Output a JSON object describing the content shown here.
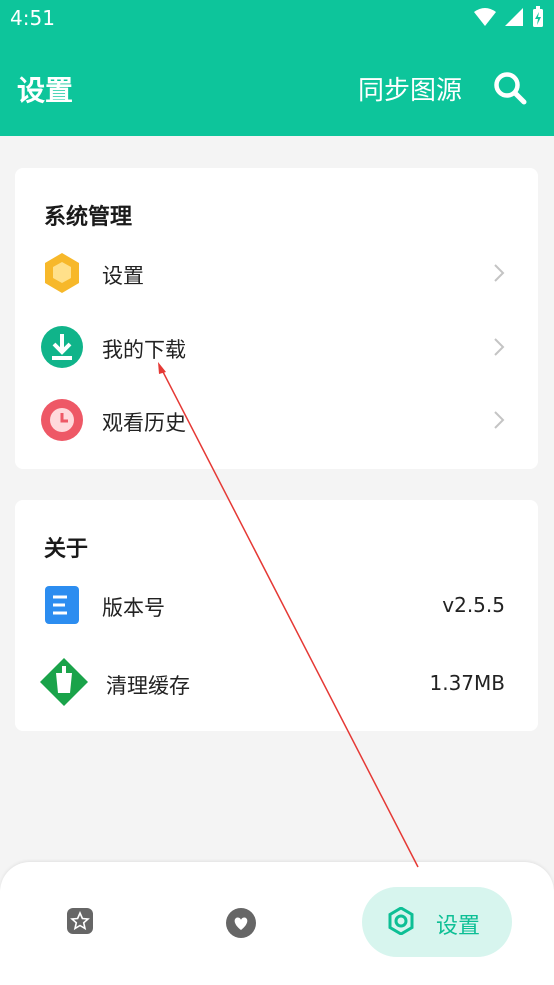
{
  "status_bar": {
    "time": "4:51"
  },
  "header": {
    "title": "设置",
    "sync_label": "同步图源",
    "search_icon": "search-icon"
  },
  "system_section": {
    "title": "系统管理",
    "items": [
      {
        "label": "设置",
        "icon": "hexagon-settings-icon"
      },
      {
        "label": "我的下载",
        "icon": "download-icon"
      },
      {
        "label": "观看历史",
        "icon": "clock-icon"
      }
    ]
  },
  "about_section": {
    "title": "关于",
    "items": [
      {
        "label": "版本号",
        "value": "v2.5.5",
        "icon": "document-icon"
      },
      {
        "label": "清理缓存",
        "value": "1.37MB",
        "icon": "broom-icon"
      }
    ]
  },
  "bottom_nav": {
    "items": [
      {
        "icon": "star-icon",
        "label": ""
      },
      {
        "icon": "heart-icon",
        "label": ""
      },
      {
        "icon": "gear-icon",
        "label": "设置"
      }
    ],
    "active_index": 2
  },
  "colors": {
    "accent": "#0dc59b",
    "nav_active_bg": "#d7f5ee",
    "annotation": "#e53935"
  }
}
